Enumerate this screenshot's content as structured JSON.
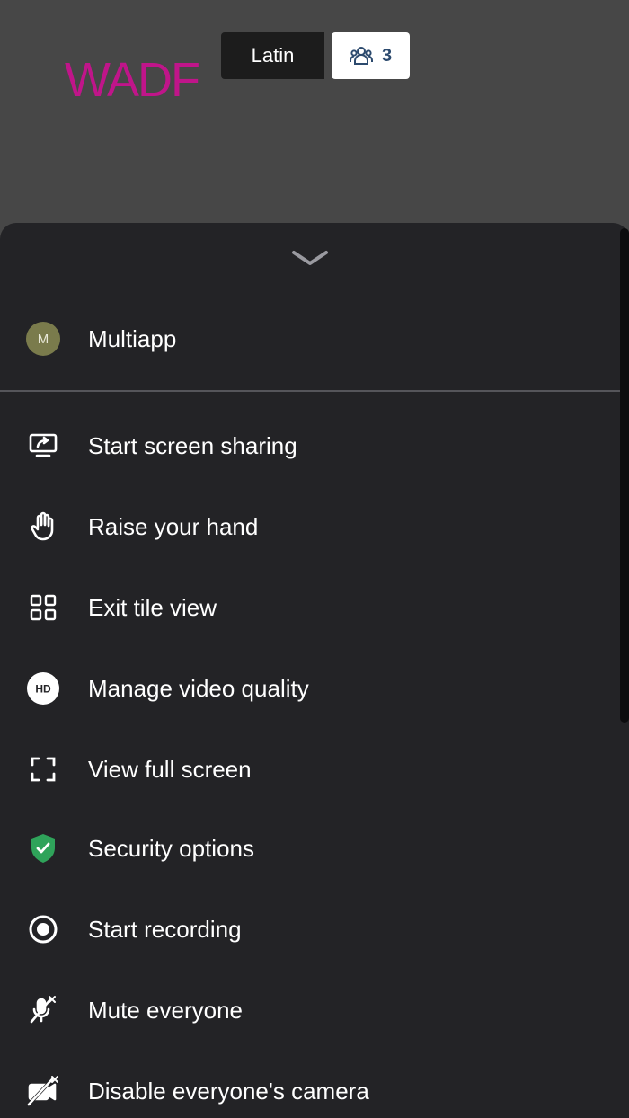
{
  "header": {
    "logo_text": "WADF",
    "language_label": "Latin",
    "participant_count": "3"
  },
  "sheet": {
    "user": {
      "avatar_initial": "M",
      "name": "Multiapp"
    },
    "menu": [
      {
        "label": "Start screen sharing",
        "icon": "screen-share-icon"
      },
      {
        "label": "Raise your hand",
        "icon": "raise-hand-icon"
      },
      {
        "label": "Exit tile view",
        "icon": "tile-view-icon"
      },
      {
        "label": "Manage video quality",
        "icon": "hd-icon"
      },
      {
        "label": "View full screen",
        "icon": "fullscreen-icon"
      },
      {
        "label": "Security options",
        "icon": "shield-icon"
      },
      {
        "label": "Start recording",
        "icon": "record-icon"
      },
      {
        "label": "Mute everyone",
        "icon": "mic-muted-icon"
      },
      {
        "label": "Disable everyone's camera",
        "icon": "camera-off-icon"
      }
    ]
  },
  "colors": {
    "background": "#474747",
    "sheet": "#232326",
    "logo": "#c0158a",
    "shield": "#2fa35a",
    "avatar": "#7a7b4c"
  }
}
